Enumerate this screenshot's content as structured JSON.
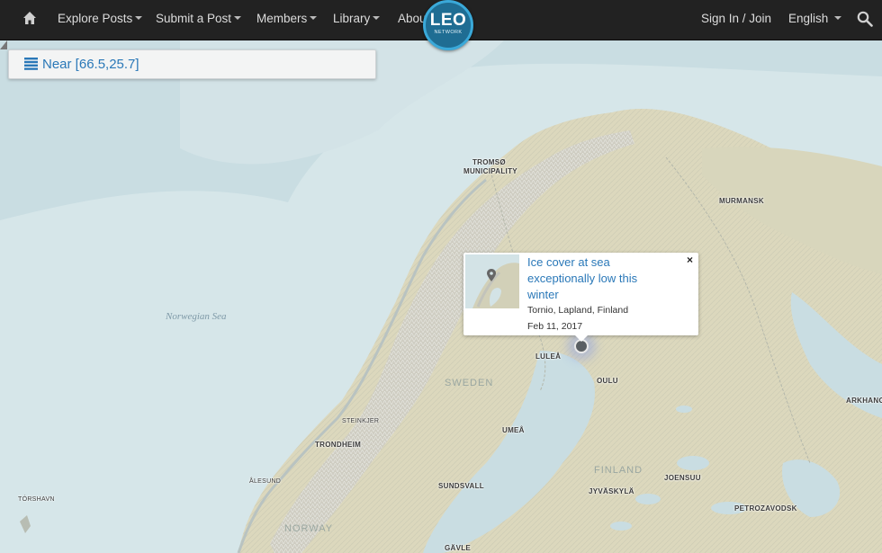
{
  "nav": {
    "home_icon": "home-icon",
    "items": [
      {
        "label": "Explore Posts",
        "has_caret": true
      },
      {
        "label": "Submit a Post",
        "has_caret": true
      },
      {
        "label": "Members",
        "has_caret": true
      },
      {
        "label": "Library",
        "has_caret": true
      },
      {
        "label": "Abou",
        "has_caret": false
      }
    ],
    "signin_label": "Sign In / Join",
    "language_label": "English",
    "search_icon": "search-icon"
  },
  "logo": {
    "main": "LEO",
    "sub": "NETWORK",
    "color": "#1f6d93",
    "ring_color": "#3aa9d9"
  },
  "location_panel": {
    "icon": "list-icon",
    "label": "Near [66.5,25.7]"
  },
  "popup": {
    "title": "Ice cover at sea exceptionally low this winter",
    "place": "Tornio, Lapland, Finland",
    "date": "Feb 11, 2017",
    "close_label": "×",
    "thumb_icon": "map-pin-icon"
  },
  "map": {
    "labels": {
      "tromso": "TROMSØ",
      "tromso_sub": "MUNICIPALITY",
      "murmansk": "MURMANSK",
      "norwegian_sea": "Norwegian Sea",
      "lulea": "LULEÅ",
      "sweden": "SWEDEN",
      "oulu": "OULU",
      "arkhang": "ARKHANG",
      "steinkjer": "STEINKJER",
      "umea": "UMEÅ",
      "trondheim": "TRONDHEIM",
      "finland": "FINLAND",
      "joensuu": "JOENSUU",
      "alesund": "ÅLESUND",
      "sundsvall": "SUNDSVALL",
      "jyvaskyla": "JYVÄSKYLÄ",
      "torshavn": "TÓRSHAVN",
      "petrozavodsk": "PETROZAVODSK",
      "norway": "NORWAY",
      "gavle": "GÄVLE"
    },
    "colors": {
      "sea": "#c9dde2",
      "shallow": "#d8e8ea",
      "land": "#dcd8bd",
      "mountain": "#c6c8bf",
      "forest": "#d2d4b6"
    }
  }
}
